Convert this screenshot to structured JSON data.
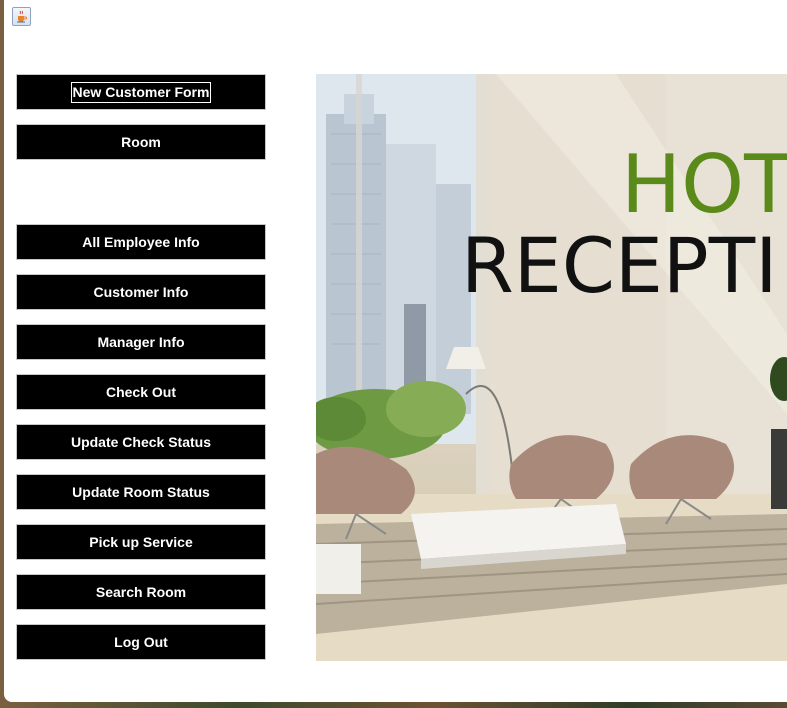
{
  "window": {
    "icon": "java-coffee-cup-icon"
  },
  "menu": {
    "buttons": [
      {
        "label": "New Customer Form",
        "name": "new-customer-form-button"
      },
      {
        "label": "Room",
        "name": "room-button"
      },
      {
        "label": "All Employee Info",
        "name": "all-employee-info-button"
      },
      {
        "label": "Customer Info",
        "name": "customer-info-button"
      },
      {
        "label": "Manager Info",
        "name": "manager-info-button"
      },
      {
        "label": "Check Out",
        "name": "check-out-button"
      },
      {
        "label": "Update Check Status",
        "name": "update-check-status-button"
      },
      {
        "label": "Update Room Status",
        "name": "update-room-status-button"
      },
      {
        "label": "Pick up Service",
        "name": "pick-up-service-button"
      },
      {
        "label": "Search Room",
        "name": "search-room-button"
      },
      {
        "label": "Log Out",
        "name": "log-out-button"
      }
    ]
  },
  "hero": {
    "line1": "HOT",
    "line2": "RECEPTI",
    "line1_color": "#5a8a1a",
    "line2_color": "#111111"
  }
}
